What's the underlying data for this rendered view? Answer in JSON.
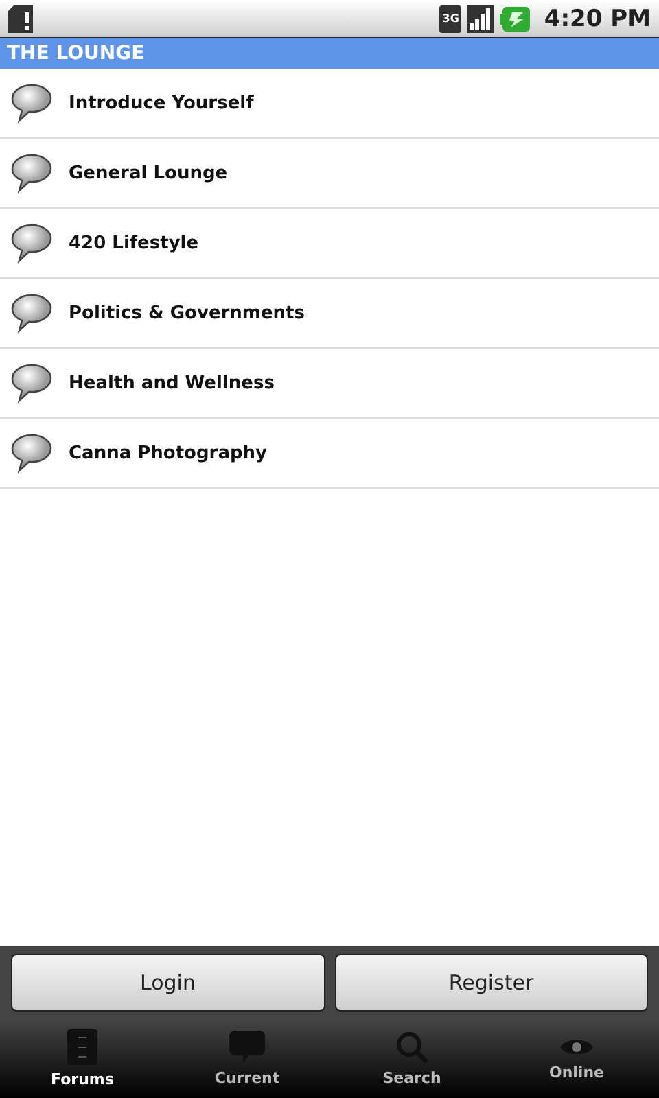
{
  "status_bar": {
    "time": "4:20 PM",
    "network": "3G"
  },
  "section": {
    "title": "THE LOUNGE"
  },
  "forums": [
    {
      "title": "Introduce Yourself"
    },
    {
      "title": "General Lounge"
    },
    {
      "title": "420 Lifestyle"
    },
    {
      "title": "Politics & Governments"
    },
    {
      "title": "Health and Wellness"
    },
    {
      "title": "Canna Photography"
    }
  ],
  "buttons": [
    "Login",
    "Register"
  ],
  "tabs": [
    {
      "label": "Forums",
      "kind": "forums",
      "selected": true
    },
    {
      "label": "Current",
      "kind": "current",
      "selected": false
    },
    {
      "label": "Search",
      "kind": "search",
      "selected": false
    },
    {
      "label": "Online",
      "kind": "online",
      "selected": false
    }
  ]
}
